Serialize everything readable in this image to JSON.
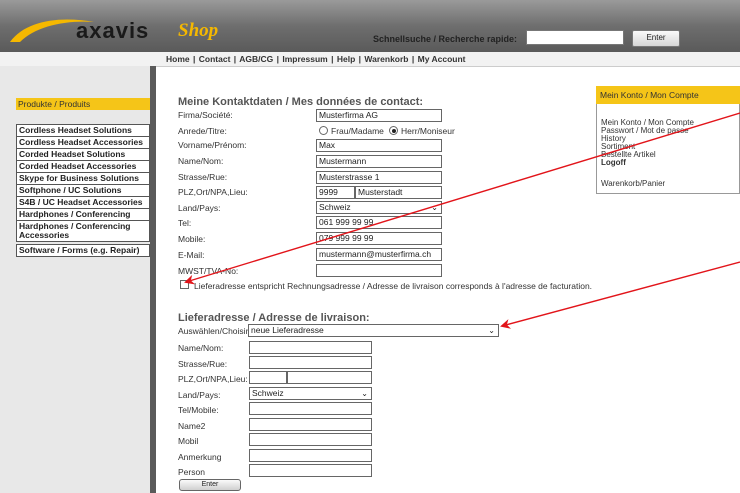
{
  "header": {
    "logo_main": "axavis",
    "logo_accent": "Shop",
    "search_label": "Schnellsuche / Recherche rapide:",
    "search_value": "",
    "search_button": "Enter"
  },
  "topnav": {
    "links": [
      "Home",
      "Contact",
      "AGB/CG",
      "Impressum",
      "Help",
      "Warenkorb",
      "My Account"
    ],
    "separator": "|"
  },
  "sidebar": {
    "header": "Produkte / Produits",
    "items": [
      "Cordless Headset Solutions",
      "Cordless Headset Accessories",
      "Corded Headset Solutions",
      "Corded Headset Accessories",
      "Skype for Business Solutions",
      "Softphone / UC Solutions",
      "S4B / UC Headset Accessories",
      "Hardphones / Conferencing",
      "Hardphones / Conferencing Accessories",
      "Software / Forms (e.g. Repair)"
    ]
  },
  "contact": {
    "heading": "Meine Kontaktdaten / Mes données de contact:",
    "company_label": "Firma/Société:",
    "company_value": "Musterfirma AG",
    "salutation_label": "Anrede/Titre:",
    "salutation_options": [
      "Frau/Madame",
      "Herr/Moniseur"
    ],
    "salutation_selected": "Herr/Moniseur",
    "firstname_label": "Vorname/Prénom:",
    "firstname_value": "Max",
    "lastname_label": "Name/Nom:",
    "lastname_value": "Mustermann",
    "street_label": "Strasse/Rue:",
    "street_value": "Musterstrasse 1",
    "zipcity_label": "PLZ,Ort/NPA,Lieu:",
    "zip_value": "9999",
    "city_value": "Musterstadt",
    "country_label": "Land/Pays:",
    "country_value": "Schweiz",
    "phone_label": "Tel:",
    "phone_value": "061 999 99 99",
    "mobile_label": "Mobile:",
    "mobile_value": "079 999 99 99",
    "email_label": "E-Mail:",
    "email_value": "mustermann@musterfirma.ch",
    "vat_label": "MWST/TVA-No:",
    "vat_value": "",
    "same_address_label": "Lieferadresse entspricht Rechnungsadresse / Adresse de livraison corresponds à l'adresse de facturation."
  },
  "delivery": {
    "heading": "Lieferadresse / Adresse de livraison:",
    "choose_label": "Auswählen/Choisir:",
    "choose_value": "neue Lieferadresse",
    "name_label": "Name/Nom:",
    "street_label": "Strasse/Rue:",
    "zipcity_label": "PLZ,Ort/NPA,Lieu:",
    "country_label": "Land/Pays:",
    "country_value": "Schweiz",
    "phone_label": "Tel/Mobile:",
    "name2_label": "Name2",
    "mobil_label": "Mobil",
    "remark_label": "Anmerkung",
    "person_label": "Person",
    "submit_button": "Enter"
  },
  "account": {
    "header": "Mein Konto / Mon Compte",
    "items": [
      "Mein Konto / Mon Compte",
      "Passwort / Mot de passe",
      "History",
      "Sortiment",
      "Bestellte Artikel",
      "Logoff"
    ],
    "cart": "Warenkorb/Panier"
  },
  "colors": {
    "accent": "#f5c518",
    "header_dark": "#5a5a5a",
    "annotation_arrow": "#e2141a"
  }
}
